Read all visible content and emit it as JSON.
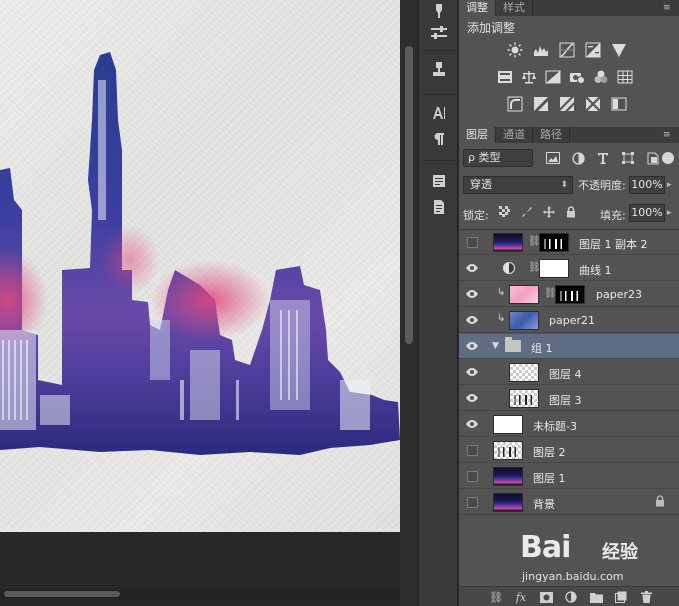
{
  "adjustments_panel": {
    "tabs": [
      {
        "label": "调整",
        "active": true
      },
      {
        "label": "样式",
        "active": false
      }
    ],
    "title": "添加调整",
    "icons_row1": [
      "brightness-contrast-icon",
      "levels-icon",
      "curves-icon",
      "exposure-icon",
      "vibrance-icon"
    ],
    "icons_row2": [
      "hue-saturation-icon",
      "color-balance-icon",
      "black-white-icon",
      "photo-filter-icon",
      "channel-mixer-icon",
      "color-lookup-icon"
    ],
    "icons_row3": [
      "invert-icon",
      "posterize-icon",
      "threshold-icon",
      "selective-color-icon",
      "gradient-map-icon"
    ]
  },
  "layers_panel": {
    "tabs": [
      {
        "label": "图层",
        "active": true
      },
      {
        "label": "通道",
        "active": false
      },
      {
        "label": "路径",
        "active": false
      }
    ],
    "filter": {
      "label": "ρ 类型",
      "icons": [
        "pixel-filter-icon",
        "adjustment-filter-icon",
        "type-filter-icon",
        "shape-filter-icon",
        "smart-object-filter-icon"
      ]
    },
    "blend_mode": "穿透",
    "opacity_label": "不透明度:",
    "opacity_value": "100%",
    "lock_label": "锁定:",
    "fill_label": "填充:",
    "fill_value": "100%",
    "layers": [
      {
        "name": "图层 1 副本 2",
        "visible": false,
        "thumb": "city",
        "mask": "mask-city",
        "linked": true,
        "indent": 0
      },
      {
        "name": "曲线 1",
        "visible": true,
        "thumb": "adjustment",
        "mask": "white",
        "linked": true,
        "indent": 0
      },
      {
        "name": "paper23",
        "visible": true,
        "thumb": "pink",
        "mask": "mask-city",
        "linked": true,
        "clipped": true,
        "indent": 0
      },
      {
        "name": "paper21",
        "visible": true,
        "thumb": "blue",
        "clipped": true,
        "indent": 0
      },
      {
        "name": "组 1",
        "visible": true,
        "type": "group",
        "selected": true,
        "indent": 0
      },
      {
        "name": "图层 4",
        "visible": true,
        "thumb": "checker",
        "indent": 1
      },
      {
        "name": "图层 3",
        "visible": true,
        "thumb": "checker-city",
        "indent": 1
      },
      {
        "name": "未标题-3",
        "visible": true,
        "thumb": "white",
        "indent": 0
      },
      {
        "name": "图层 2",
        "visible": false,
        "thumb": "checker-city",
        "indent": 0
      },
      {
        "name": "图层 1",
        "visible": false,
        "thumb": "city",
        "indent": 0
      },
      {
        "name": "背景",
        "visible": false,
        "thumb": "city",
        "locked": true,
        "indent": 0
      }
    ],
    "footer_icons": [
      "link-layers-icon",
      "fx-icon",
      "add-mask-icon",
      "new-adjustment-icon",
      "new-group-icon",
      "new-layer-icon",
      "delete-layer-icon"
    ]
  },
  "tool_strip": [
    "brush-presets-icon",
    "adjustments-sliders-icon",
    "clone-source-icon",
    "character-icon",
    "paragraph-icon",
    "notes-icon",
    "properties-icon"
  ],
  "watermark": {
    "logo": "Bai",
    "brand": "经验",
    "url": "jingyan.baidu.com"
  }
}
